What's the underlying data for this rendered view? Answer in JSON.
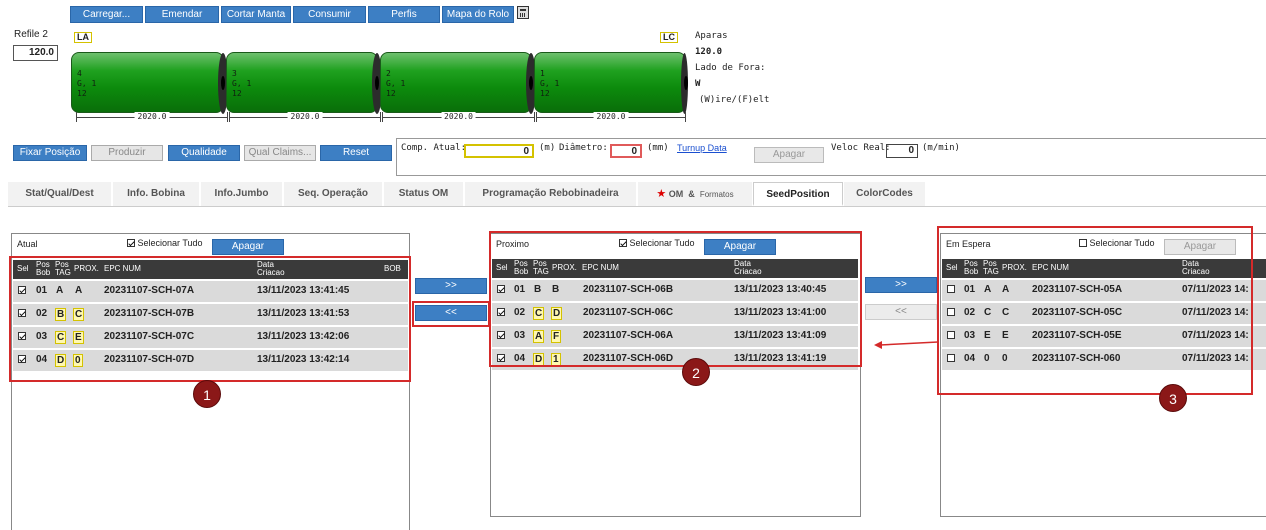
{
  "toolbar": {
    "carregar": "Carregar...",
    "emendar": "Emendar",
    "cortar_manta": "Cortar Manta",
    "consumir": "Consumir",
    "perfis": "Perfis",
    "mapa_do_rolo": "Mapa do Rolo"
  },
  "refile": {
    "label": "Refile 2",
    "value": "120.0"
  },
  "roll_labels": {
    "left": "LA",
    "right": "LC"
  },
  "rolls": [
    {
      "num": "4",
      "g": "G, 1",
      "w": "12",
      "width": "2020.0"
    },
    {
      "num": "3",
      "g": "G, 1",
      "w": "12",
      "width": "2020.0"
    },
    {
      "num": "2",
      "g": "G, 1",
      "w": "12",
      "width": "2020.0"
    },
    {
      "num": "1",
      "g": "G, 1",
      "w": "12",
      "width": "2020.0"
    }
  ],
  "side_info": {
    "aparas_label": "Aparas",
    "aparas_value": "120.0",
    "lado_label": "Lado de Fora:",
    "lado_value": "W",
    "legend": "(W)ire/(F)elt"
  },
  "actions": {
    "fixar_posicao": "Fixar Posição",
    "produzir": "Produzir",
    "qualidade": "Qualidade",
    "qual_claims": "Qual Claims...",
    "reset": "Reset"
  },
  "measures": {
    "comp_atual_label": "Comp. Atual:",
    "comp_atual_value": "0",
    "comp_unit": "(m)",
    "diametro_label": "Diâmetro:",
    "diametro_value": "0",
    "diametro_unit": "(mm)",
    "turnup_link": "Turnup Data",
    "apagar": "Apagar",
    "veloc_label": "Veloc Real:",
    "veloc_value": "0",
    "veloc_unit": "(m/min)"
  },
  "tabs": [
    "Stat/Qual/Dest",
    "Info. Bobina",
    "Info.Jumbo",
    "Seq. Operação",
    "Status OM",
    "Programação Rebobinadeira",
    "OM",
    "&",
    "Formatos",
    "SeedPosition",
    "ColorCodes"
  ],
  "headers": {
    "sel": "Sel",
    "pos_bob": [
      "Pos",
      "Bob"
    ],
    "pos_tag": [
      "Pos",
      "TAG"
    ],
    "prox": "PROX.",
    "epc": "EPC NUM",
    "data": [
      "Data",
      "Criacao"
    ],
    "bob": "BOB"
  },
  "panels": {
    "atual": {
      "title": "Atual",
      "select_all": "Selecionar Tudo",
      "apagar": "Apagar",
      "rows": [
        {
          "checked": true,
          "pos": "01",
          "tag": "A",
          "prox": "A",
          "epc": "20231107-SCH-07A",
          "data": "13/11/2023 13:41:45"
        },
        {
          "checked": true,
          "pos": "02",
          "tag": "B",
          "prox": "C",
          "epc": "20231107-SCH-07B",
          "data": "13/11/2023 13:41:53"
        },
        {
          "checked": true,
          "pos": "03",
          "tag": "C",
          "prox": "E",
          "epc": "20231107-SCH-07C",
          "data": "13/11/2023 13:42:06"
        },
        {
          "checked": true,
          "pos": "04",
          "tag": "D",
          "prox": "0",
          "epc": "20231107-SCH-07D",
          "data": "13/11/2023 13:42:14"
        }
      ]
    },
    "proximo": {
      "title": "Proximo",
      "select_all": "Selecionar Tudo",
      "apagar": "Apagar",
      "rows": [
        {
          "checked": true,
          "pos": "01",
          "tag": "B",
          "prox": "B",
          "epc": "20231107-SCH-06B",
          "data": "13/11/2023 13:40:45"
        },
        {
          "checked": true,
          "pos": "02",
          "tag": "C",
          "prox": "D",
          "epc": "20231107-SCH-06C",
          "data": "13/11/2023 13:41:00"
        },
        {
          "checked": true,
          "pos": "03",
          "tag": "A",
          "prox": "F",
          "epc": "20231107-SCH-06A",
          "data": "13/11/2023 13:41:09"
        },
        {
          "checked": true,
          "pos": "04",
          "tag": "D",
          "prox": "1",
          "epc": "20231107-SCH-06D",
          "data": "13/11/2023 13:41:19"
        }
      ]
    },
    "em_espera": {
      "title": "Em Espera",
      "select_all": "Selecionar Tudo",
      "apagar": "Apagar",
      "rows": [
        {
          "checked": false,
          "pos": "01",
          "tag": "A",
          "prox": "A",
          "epc": "20231107-SCH-05A",
          "data": "07/11/2023 14:"
        },
        {
          "checked": false,
          "pos": "02",
          "tag": "C",
          "prox": "C",
          "epc": "20231107-SCH-05C",
          "data": "07/11/2023 14:"
        },
        {
          "checked": false,
          "pos": "03",
          "tag": "E",
          "prox": "E",
          "epc": "20231107-SCH-05E",
          "data": "07/11/2023 14:"
        },
        {
          "checked": false,
          "pos": "04",
          "tag": "0",
          "prox": "0",
          "epc": "20231107-SCH-060",
          "data": "07/11/2023 14:"
        }
      ]
    }
  },
  "move_buttons": {
    "forward": ">>",
    "back": "<<"
  },
  "markers": [
    "1",
    "2",
    "3"
  ],
  "colors": {
    "accent": "#3d7fc4",
    "annotation_red": "#d42a2a",
    "marker": "#8b1818",
    "roll_green": "#1fa11f"
  }
}
